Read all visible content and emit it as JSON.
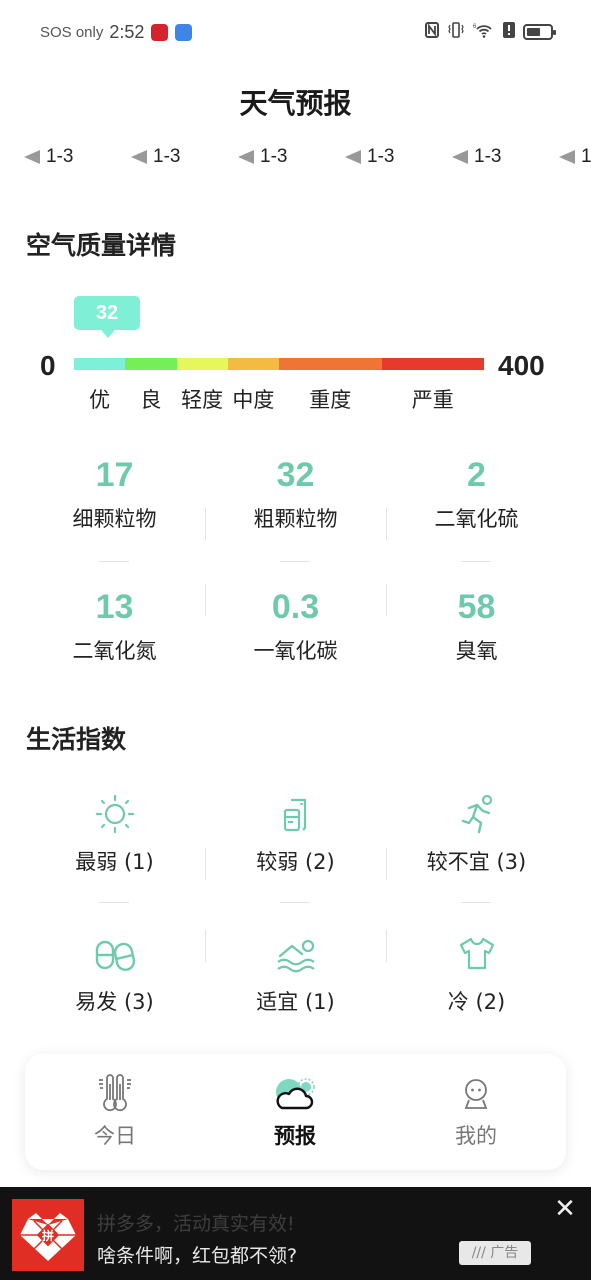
{
  "status_bar": {
    "carrier": "SOS only",
    "time": "2:52",
    "icons": [
      "nfc-icon",
      "vibrate-icon",
      "wifi-6-icon",
      "alert-icon",
      "battery-icon"
    ],
    "network_badge": "6"
  },
  "header": {
    "title": "天气预报"
  },
  "wind_forecast": [
    {
      "icon": "wind-direction-arrow-icon",
      "level": "1-3"
    },
    {
      "icon": "wind-direction-arrow-icon",
      "level": "1-3"
    },
    {
      "icon": "wind-direction-arrow-icon",
      "level": "1-3"
    },
    {
      "icon": "wind-direction-arrow-icon",
      "level": "1-3"
    },
    {
      "icon": "wind-direction-arrow-icon",
      "level": "1-3"
    },
    {
      "icon": "wind-direction-arrow-icon",
      "level": "1"
    }
  ],
  "air_quality": {
    "section_title": "空气质量详情",
    "aqi_value": "32",
    "aqi_fraction": 0.08,
    "scale_min": "0",
    "scale_max": "400",
    "levels": [
      {
        "label": "优",
        "color": "#7ff0d8",
        "range": [
          0,
          50
        ]
      },
      {
        "label": "良",
        "color": "#74ef58",
        "range": [
          50,
          100
        ]
      },
      {
        "label": "轻度",
        "color": "#e5f75a",
        "range": [
          100,
          150
        ]
      },
      {
        "label": "中度",
        "color": "#f4bb42",
        "range": [
          150,
          200
        ]
      },
      {
        "label": "重度",
        "color": "#ee7535",
        "range": [
          200,
          300
        ]
      },
      {
        "label": "严重",
        "color": "#e83a2c",
        "range": [
          300,
          400
        ]
      }
    ],
    "pollutants": [
      {
        "value": "17",
        "label": "细颗粒物"
      },
      {
        "value": "32",
        "label": "粗颗粒物"
      },
      {
        "value": "2",
        "label": "二氧化硫"
      },
      {
        "value": "13",
        "label": "二氧化氮"
      },
      {
        "value": "0.3",
        "label": "一氧化碳"
      },
      {
        "value": "58",
        "label": "臭氧"
      }
    ]
  },
  "life_index": {
    "section_title": "生活指数",
    "items": [
      {
        "icon": "sun-uv-icon",
        "label": "最弱 (1)"
      },
      {
        "icon": "car-wash-icon",
        "label": "较弱 (2)"
      },
      {
        "icon": "running-person-icon",
        "label": "较不宜 (3)"
      },
      {
        "icon": "pill-capsule-icon",
        "label": "易发 (3)"
      },
      {
        "icon": "swimming-icon",
        "label": "适宜 (1)"
      },
      {
        "icon": "shirt-icon",
        "label": "冷 (2)"
      }
    ]
  },
  "bottom_nav": {
    "items": [
      {
        "icon": "thermometer-icon",
        "label": "今日",
        "active": false
      },
      {
        "icon": "cloud-sun-icon",
        "label": "预报",
        "active": true
      },
      {
        "icon": "person-icon",
        "label": "我的",
        "active": false
      }
    ]
  },
  "ad_banner": {
    "title": "拼多多，活动真实有效!",
    "text": "啥条件啊，红包都不领?",
    "badge": "广告",
    "close": "✕",
    "accent": "#e02e24"
  },
  "colors": {
    "accent_teal": "#6fc9ad",
    "bubble": "#7ff0d5"
  }
}
